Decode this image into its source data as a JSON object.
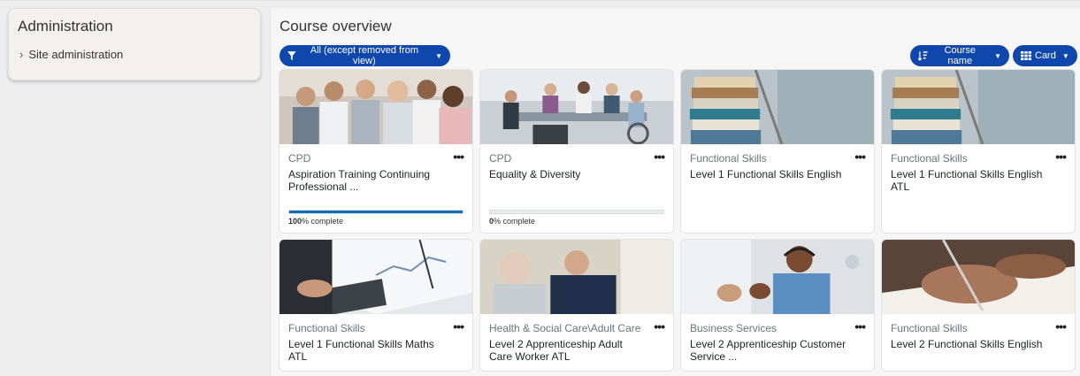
{
  "sidebar": {
    "title": "Administration",
    "items": [
      {
        "label": "Site administration"
      }
    ]
  },
  "main": {
    "title": "Course overview",
    "filter": {
      "label": "All (except removed from view)"
    },
    "sort": {
      "label": "Course name"
    },
    "view": {
      "label": "Card"
    }
  },
  "colors": {
    "accent": "#0f47ad",
    "progress": "#0f6cbf"
  },
  "courses": [
    {
      "category": "CPD",
      "name": "Aspiration Training Continuing Professional ...",
      "progress": 100,
      "progress_pct": "100",
      "progress_suffix": "% complete",
      "image": "group-of-professionals"
    },
    {
      "category": "CPD",
      "name": "Equality & Diversity",
      "progress": 0,
      "progress_pct": "0",
      "progress_suffix": "% complete",
      "image": "office-meeting"
    },
    {
      "category": "Functional Skills",
      "name": "Level 1 Functional Skills English",
      "image": "stack-of-books"
    },
    {
      "category": "Functional Skills",
      "name": "Level 1 Functional Skills English ATL",
      "image": "stack-of-books"
    },
    {
      "category": "Functional Skills",
      "name": "Level 1 Functional Skills Maths ATL",
      "image": "calculator-and-charts"
    },
    {
      "category": "Health & Social Care\\Adult Care",
      "name": "Level 2 Apprenticeship Adult Care Worker ATL",
      "image": "carer-with-elderly-man"
    },
    {
      "category": "Business Services",
      "name": "Level 2 Apprenticeship Customer Service ...",
      "image": "call-centre-agent"
    },
    {
      "category": "Functional Skills",
      "name": "Level 2 Functional Skills English",
      "image": "hand-writing"
    }
  ]
}
